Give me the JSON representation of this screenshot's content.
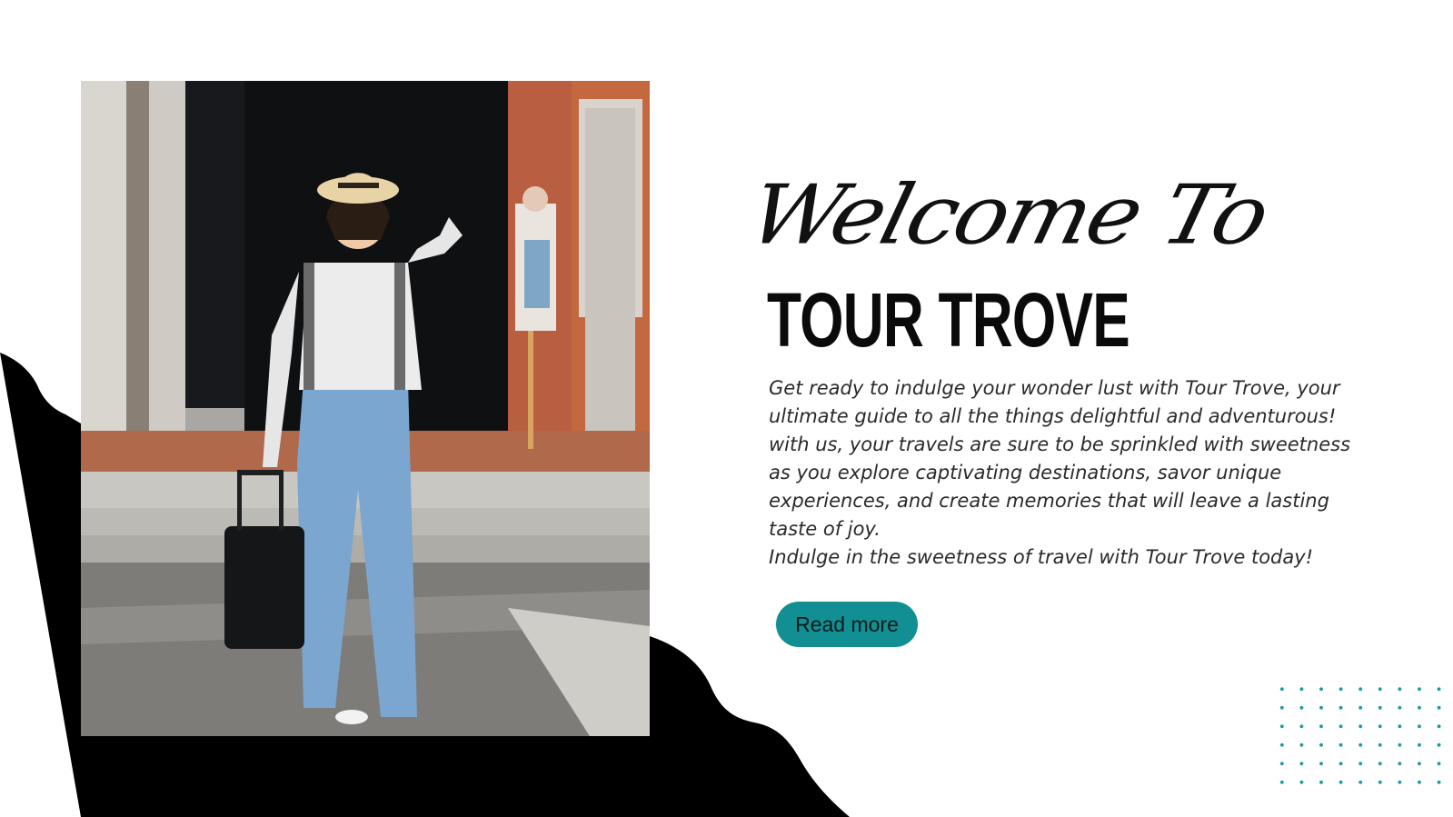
{
  "hero": {
    "welcome_script": "Welcome To",
    "brand_name": "TOUR TROVE",
    "description_lines": [
      "Get ready to indulge your wonder lust with Tour Trove, your",
      "ultimate guide to all the things delightful and adventurous!",
      "with us, your travels are sure to be sprinkled with sweetness",
      "as you explore captivating destinations, savor unique",
      "experiences, and create memories that will leave a lasting",
      "taste of joy.",
      "Indulge in the sweetness of travel with Tour Trove today!"
    ],
    "read_more_label": "Read more"
  },
  "colors": {
    "accent": "#128f93",
    "dots": "#1a9aa0",
    "text": "#2a2a2a",
    "background": "#ffffff",
    "shape": "#000000"
  },
  "icons": {
    "photo": "traveler-photo",
    "decor": "dot-grid-decoration"
  }
}
